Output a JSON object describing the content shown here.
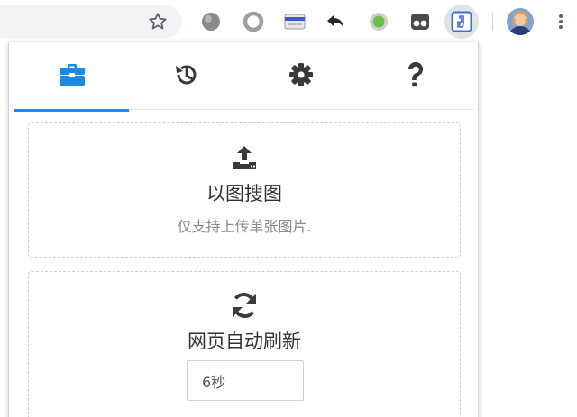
{
  "colors": {
    "accent": "#1e88e5",
    "icon_dark": "#3a3a3a",
    "title_text": "#333333",
    "sub_text": "#8a8a8a"
  },
  "toolbar": {
    "bookmark_icon": "star-outline-icon",
    "extensions": [
      {
        "name": "gray-globe-extension",
        "icon": "globe-icon"
      },
      {
        "name": "gray-ring-extension",
        "icon": "ring-icon"
      },
      {
        "name": "card-extension",
        "icon": "card-icon"
      },
      {
        "name": "undo-extension",
        "icon": "undo-arrow-icon"
      },
      {
        "name": "green-dot-extension",
        "icon": "green-dot-icon"
      },
      {
        "name": "tampermonkey-extension",
        "icon": "two-eyes-icon"
      },
      {
        "name": "active-extension",
        "icon": "music-note-icon"
      }
    ],
    "avatar_icon": "user-avatar",
    "menu_icon": "vertical-dots-icon"
  },
  "popup": {
    "tabs": [
      {
        "name": "tools",
        "icon": "toolbox-icon",
        "active": true
      },
      {
        "name": "history",
        "icon": "history-icon",
        "active": false
      },
      {
        "name": "settings",
        "icon": "gear-icon",
        "active": false
      },
      {
        "name": "help",
        "icon": "question-icon",
        "active": false
      }
    ],
    "image_search": {
      "icon": "upload-icon",
      "title": "以图搜图",
      "subtitle": "仅支持上传单张图片."
    },
    "auto_refresh": {
      "icon": "refresh-icon",
      "title": "网页自动刷新",
      "interval_value": "6秒"
    }
  }
}
